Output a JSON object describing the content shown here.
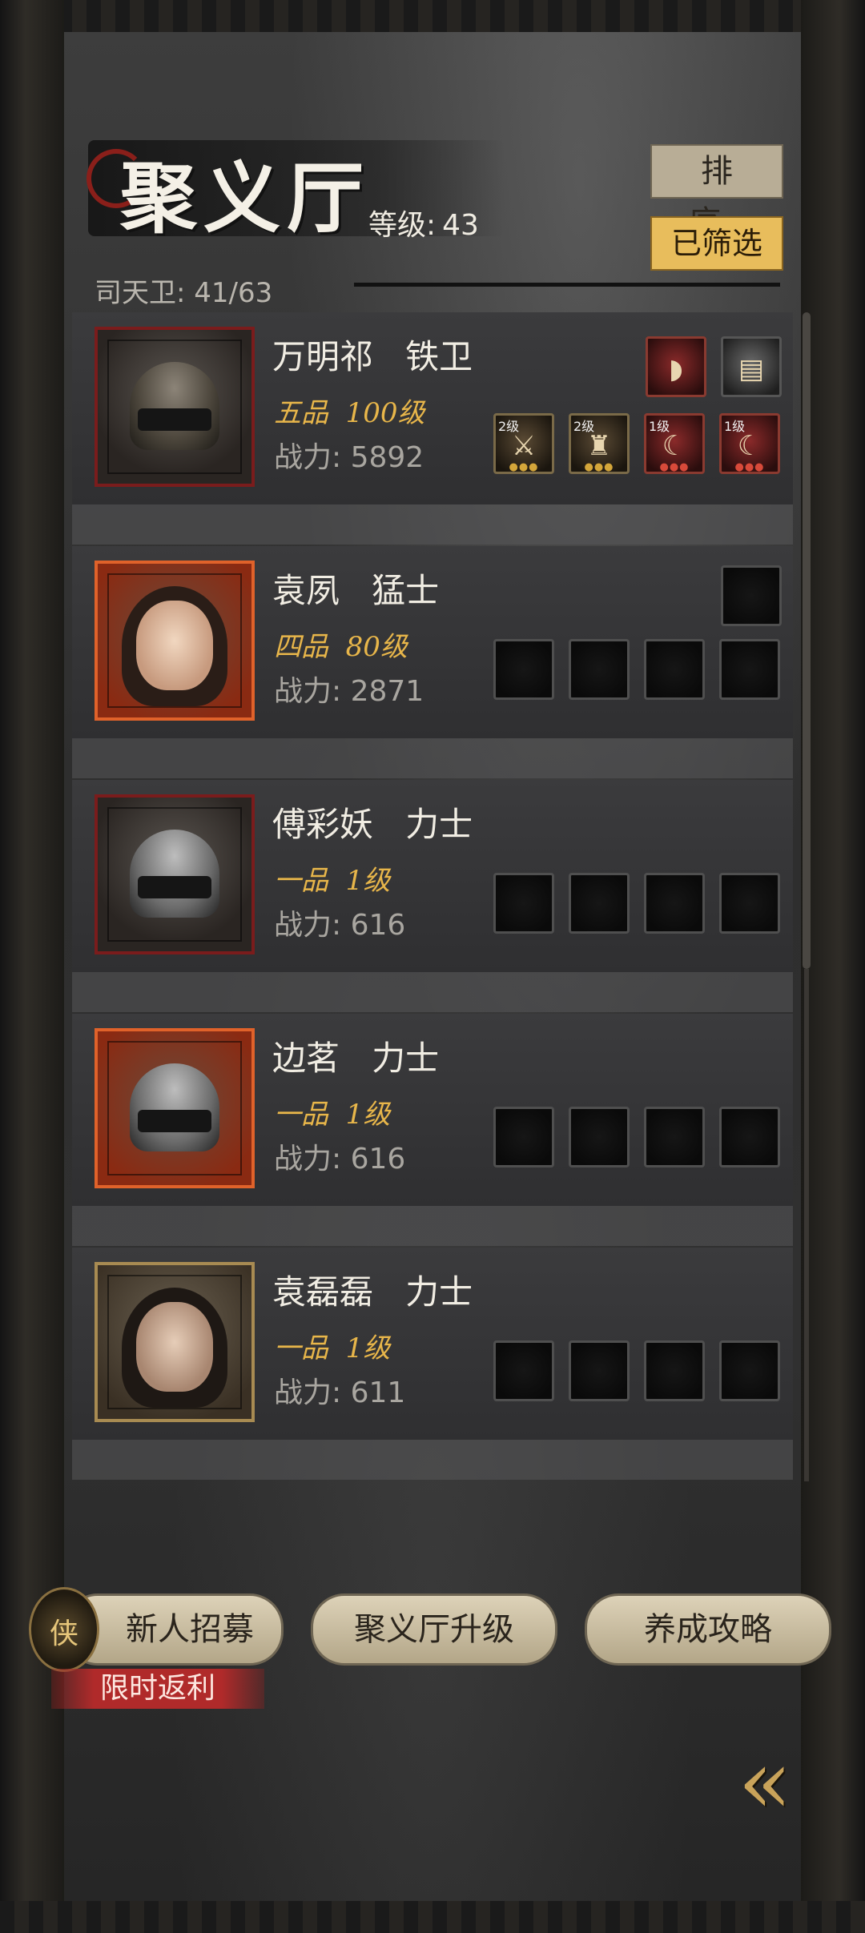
{
  "header": {
    "title": "聚义厅",
    "level_label": "等级:",
    "level_value": "43",
    "guard_count": "司天卫: 41/63",
    "sort_button": "排序",
    "filter_button": "已筛选"
  },
  "heroes": [
    {
      "name": "万明祁",
      "class": "铁卫",
      "rank": "五品",
      "level": "100级",
      "power_label": "战力:",
      "power": "5892",
      "top_slots": [
        "helmet-red",
        "chest-gear"
      ],
      "equip_slots": [
        {
          "level": "2级",
          "icon": "weapon"
        },
        {
          "level": "2级",
          "icon": "armor"
        },
        {
          "level": "1级",
          "icon": "claw"
        },
        {
          "level": "1级",
          "icon": "claw"
        }
      ]
    },
    {
      "name": "袁夙",
      "class": "猛士",
      "rank": "四品",
      "level": "80级",
      "power_label": "战力:",
      "power": "2871"
    },
    {
      "name": "傅彩妖",
      "class": "力士",
      "rank": "一品",
      "level": "1级",
      "power_label": "战力:",
      "power": "616"
    },
    {
      "name": "边茗",
      "class": "力士",
      "rank": "一品",
      "level": "1级",
      "power_label": "战力:",
      "power": "616"
    },
    {
      "name": "袁磊磊",
      "class": "力士",
      "rank": "一品",
      "level": "1级",
      "power_label": "战力:",
      "power": "611"
    }
  ],
  "footer": {
    "recruit_button": "新人招募",
    "recruit_emblem_char": "侠",
    "promo_badge": "限时返利",
    "upgrade_button": "聚义厅升级",
    "guide_button": "养成攻略",
    "back_glyph": "«"
  },
  "colors": {
    "rank_text": "#e8b64a",
    "filter_button_bg": "#e8bd5c",
    "sort_button_bg": "#b8ad96",
    "promo_bg": "#b02a2a"
  }
}
